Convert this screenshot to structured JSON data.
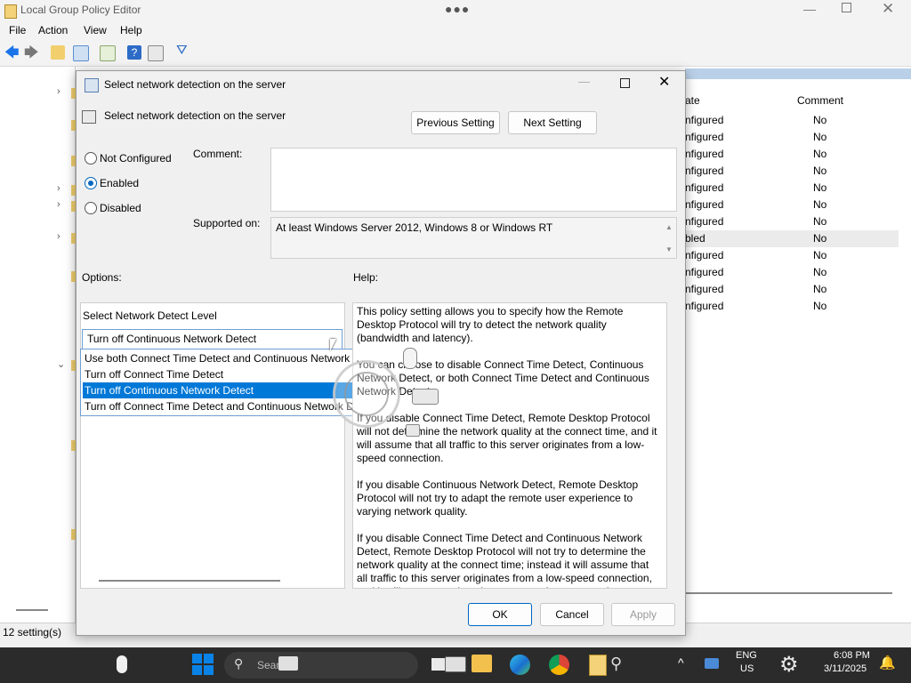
{
  "app": {
    "title": "Local Group Policy Editor"
  },
  "menu": [
    "File",
    "Action",
    "View",
    "Help"
  ],
  "list": {
    "headers": {
      "state": "ate",
      "comment": "Comment"
    },
    "rows": [
      {
        "state": "nfigured",
        "comment": "No"
      },
      {
        "state": "nfigured",
        "comment": "No"
      },
      {
        "state": "nfigured",
        "comment": "No"
      },
      {
        "state": "nfigured",
        "comment": "No"
      },
      {
        "state": "nfigured",
        "comment": "No"
      },
      {
        "state": "nfigured",
        "comment": "No"
      },
      {
        "state": "nfigured",
        "comment": "No"
      },
      {
        "state": "bled",
        "comment": "No"
      },
      {
        "state": "nfigured",
        "comment": "No"
      },
      {
        "state": "nfigured",
        "comment": "No"
      },
      {
        "state": "nfigured",
        "comment": "No"
      },
      {
        "state": "nfigured",
        "comment": "No"
      }
    ]
  },
  "status": {
    "text": "12 setting(s)"
  },
  "dialog": {
    "title": "Select network detection on the server",
    "setting_name": "Select network detection on the server",
    "prev_button": "Previous Setting",
    "next_button": "Next Setting",
    "radios": {
      "not_configured": "Not Configured",
      "enabled": "Enabled",
      "disabled": "Disabled",
      "selected": "Enabled"
    },
    "comment_label": "Comment:",
    "comment_value": "",
    "supported_label": "Supported on:",
    "supported_value": "At least Windows Server 2012, Windows 8 or Windows RT",
    "options_label": "Options:",
    "help_label": "Help:",
    "detect_level_label": "Select Network Detect Level",
    "dropdown_value": "Turn off Continuous Network Detect",
    "dropdown_options": [
      "Use both Connect Time Detect and Continuous Network Detect",
      "Turn off Connect Time Detect",
      "Turn off Continuous Network Detect",
      "Turn off Connect Time Detect and Continuous Network Detect"
    ],
    "dropdown_highlighted_index": 2,
    "help_paragraphs": [
      "This policy setting allows you to specify how the Remote Desktop Protocol will try to detect the network quality (bandwidth and latency).",
      "You can choose to disable Connect Time Detect, Continuous Network Detect, or both Connect Time Detect and Continuous Network Detect.",
      "If you disable Connect Time Detect, Remote Desktop Protocol will not determine the network quality at the connect time, and it will assume that all traffic to this server originates from a low-speed connection.",
      "If you disable Continuous Network Detect, Remote Desktop Protocol will not try to adapt the remote user experience to varying network quality.",
      "If you disable Connect Time Detect and Continuous Network Detect, Remote Desktop Protocol will not try to determine the network quality at the connect time; instead it will assume that all traffic to this server originates from a low-speed connection, and it will not try to adapt the user experience to varying network quality."
    ],
    "ok": "OK",
    "cancel": "Cancel",
    "apply": "Apply"
  },
  "taskbar": {
    "search_placeholder": "Search",
    "lang1": "ENG",
    "lang2": "US",
    "time": "6:08 PM",
    "date": "3/11/2025"
  },
  "colors": {
    "accent": "#0078d7",
    "radio": "#0067c0",
    "taskbar": "#2b2b2b"
  }
}
